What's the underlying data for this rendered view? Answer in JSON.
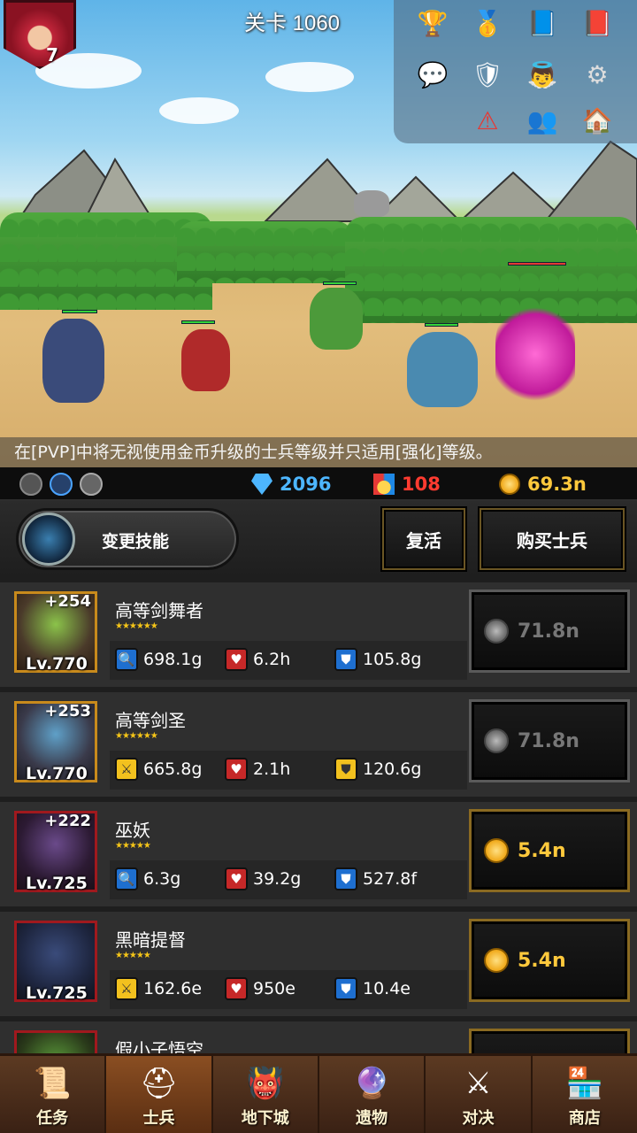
{
  "stage": {
    "title": "关卡 1060"
  },
  "player": {
    "level": "7"
  },
  "top_icons": [
    {
      "name": "trophy-icon",
      "glyph": "🏆"
    },
    {
      "name": "ranking-podium-icon",
      "glyph": "🥇"
    },
    {
      "name": "knight-book-icon",
      "glyph": "📘"
    },
    {
      "name": "sword-book-icon",
      "glyph": "📕"
    },
    {
      "name": "chat-icon",
      "glyph": "💬"
    },
    {
      "name": "guild-crest-icon",
      "glyph": "🛡"
    },
    {
      "name": "angel-icon",
      "glyph": "👼"
    },
    {
      "name": "settings-gear-icon",
      "glyph": "⚙"
    },
    {
      "name": "warning-triangle-icon",
      "glyph": "⚠"
    },
    {
      "name": "friends-icon",
      "glyph": "👥"
    },
    {
      "name": "house-icon",
      "glyph": "🏠"
    }
  ],
  "notice": "在[PVP]中将无视使用金币升级的士兵等级并只适用[强化]等级。",
  "currency": {
    "gems": "2096",
    "medals": "108",
    "gold": "69.3n",
    "colors": {
      "gems": "#4db6ff",
      "medals": "#ff3b30",
      "gold": "#ffc93c"
    }
  },
  "actions": {
    "change_skill": "变更技能",
    "revive": "复活",
    "buy_soldier": "购买士兵"
  },
  "soldiers": [
    {
      "name": "高等剑舞者",
      "plus": "+254",
      "level": "Lv.770",
      "stars": "★★★★★★",
      "stats": [
        {
          "icon": "magnifier-icon",
          "value": "698.1g"
        },
        {
          "icon": "heart-icon",
          "value": "6.2h"
        },
        {
          "icon": "shield-icon",
          "value": "105.8g"
        }
      ],
      "price": "71.8n",
      "price_type": "silver"
    },
    {
      "name": "高等剑圣",
      "plus": "+253",
      "level": "Lv.770",
      "stars": "★★★★★★",
      "stats": [
        {
          "icon": "sword-icon",
          "value": "665.8g"
        },
        {
          "icon": "heart-icon",
          "value": "2.1h"
        },
        {
          "icon": "shield-icon",
          "value": "120.6g"
        }
      ],
      "price": "71.8n",
      "price_type": "silver"
    },
    {
      "name": "巫妖",
      "plus": "+222",
      "level": "Lv.725",
      "stars": "★★★★★",
      "stats": [
        {
          "icon": "magnifier-icon",
          "value": "6.3g"
        },
        {
          "icon": "heart-icon",
          "value": "39.2g"
        },
        {
          "icon": "shield-icon",
          "value": "527.8f"
        }
      ],
      "price": "5.4n",
      "price_type": "gold"
    },
    {
      "name": "黑暗提督",
      "plus": "",
      "level": "Lv.725",
      "stars": "★★★★★",
      "stats": [
        {
          "icon": "sword-icon",
          "value": "162.6e"
        },
        {
          "icon": "heart-icon",
          "value": "950e"
        },
        {
          "icon": "shield-icon",
          "value": "10.4e"
        }
      ],
      "price": "5.4n",
      "price_type": "gold"
    },
    {
      "name": "假小子悟空",
      "plus": "",
      "level": "",
      "stars": "",
      "stats": [],
      "price": "",
      "price_type": "gold"
    }
  ],
  "nav": [
    {
      "label": "任务",
      "icon": "scroll-quest-icon",
      "glyph": "📜",
      "active": false
    },
    {
      "label": "士兵",
      "icon": "soldier-helmet-icon",
      "glyph": "⛑",
      "active": true
    },
    {
      "label": "地下城",
      "icon": "dungeon-monster-icon",
      "glyph": "👹",
      "active": false
    },
    {
      "label": "遗物",
      "icon": "relic-orb-icon",
      "glyph": "🔮",
      "active": false
    },
    {
      "label": "对决",
      "icon": "crossed-swords-icon",
      "glyph": "⚔",
      "active": false
    },
    {
      "label": "商店",
      "icon": "shop-icon",
      "glyph": "🏪",
      "active": false
    }
  ]
}
